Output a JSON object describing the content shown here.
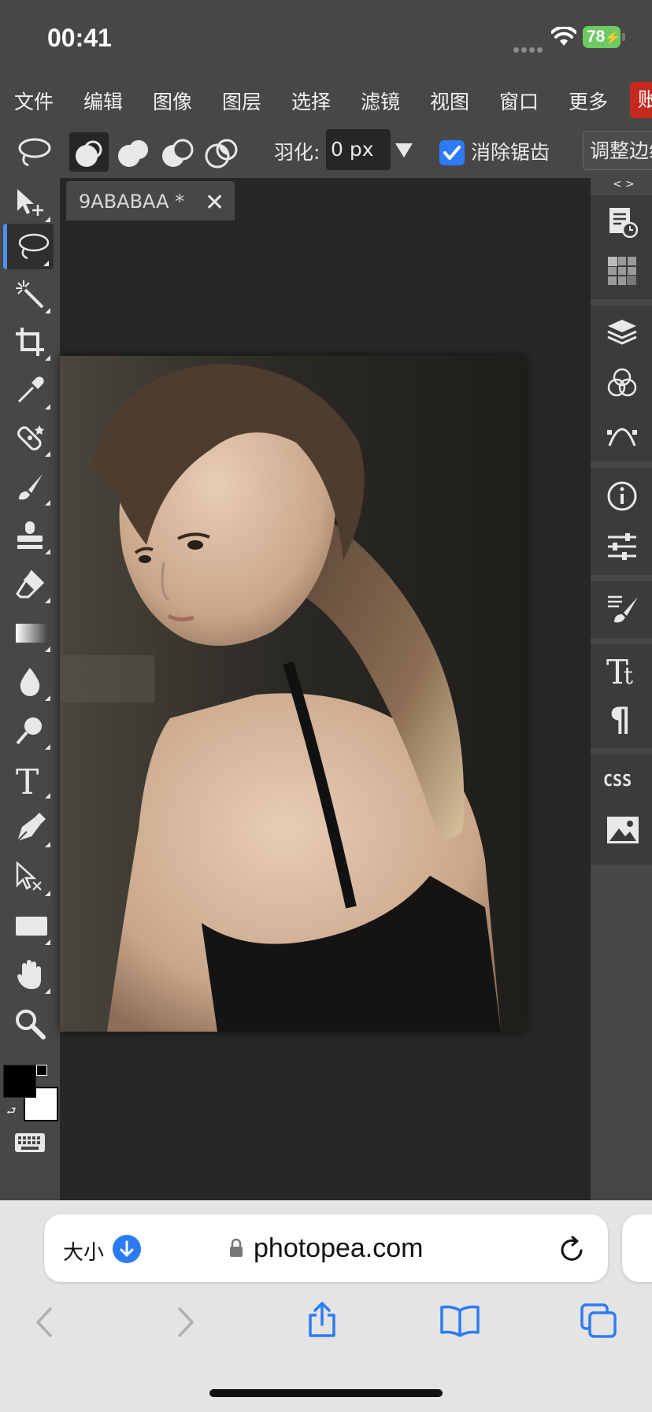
{
  "status_bar": {
    "time": "00:41",
    "battery": "78"
  },
  "menu": {
    "items": [
      "文件",
      "编辑",
      "图像",
      "图层",
      "选择",
      "滤镜",
      "视图",
      "窗口",
      "更多"
    ],
    "account": "账"
  },
  "options": {
    "feather_label": "羽化:",
    "feather_value": "0 px",
    "antialias_label": "消除锯齿",
    "antialias_checked": true,
    "refine_edge": "调整边缘"
  },
  "document": {
    "tab_name": "9ABABAA",
    "tab_modified": "*"
  },
  "browser": {
    "text_size_label": "大小",
    "url": "photopea.com"
  },
  "colors": {
    "accent": "#2d7bf4",
    "account_button": "#c5281c",
    "battery": "#6ecb63",
    "foreground_color": "#000000",
    "background_color": "#ffffff"
  },
  "toolbar": {
    "active_tool": "lasso",
    "tools": [
      "move",
      "lasso",
      "magic-wand",
      "crop",
      "eyedropper",
      "healing",
      "brush",
      "stamp",
      "eraser",
      "gradient",
      "blur",
      "dodge",
      "type",
      "pen",
      "path-select",
      "shape",
      "hand",
      "zoom",
      "colors",
      "keyboard"
    ]
  },
  "right_panel": {
    "icons": [
      "history",
      "swatches",
      "layers",
      "channels",
      "paths",
      "info",
      "adjustments",
      "brush-settings",
      "character",
      "paragraph",
      "css",
      "image"
    ]
  }
}
